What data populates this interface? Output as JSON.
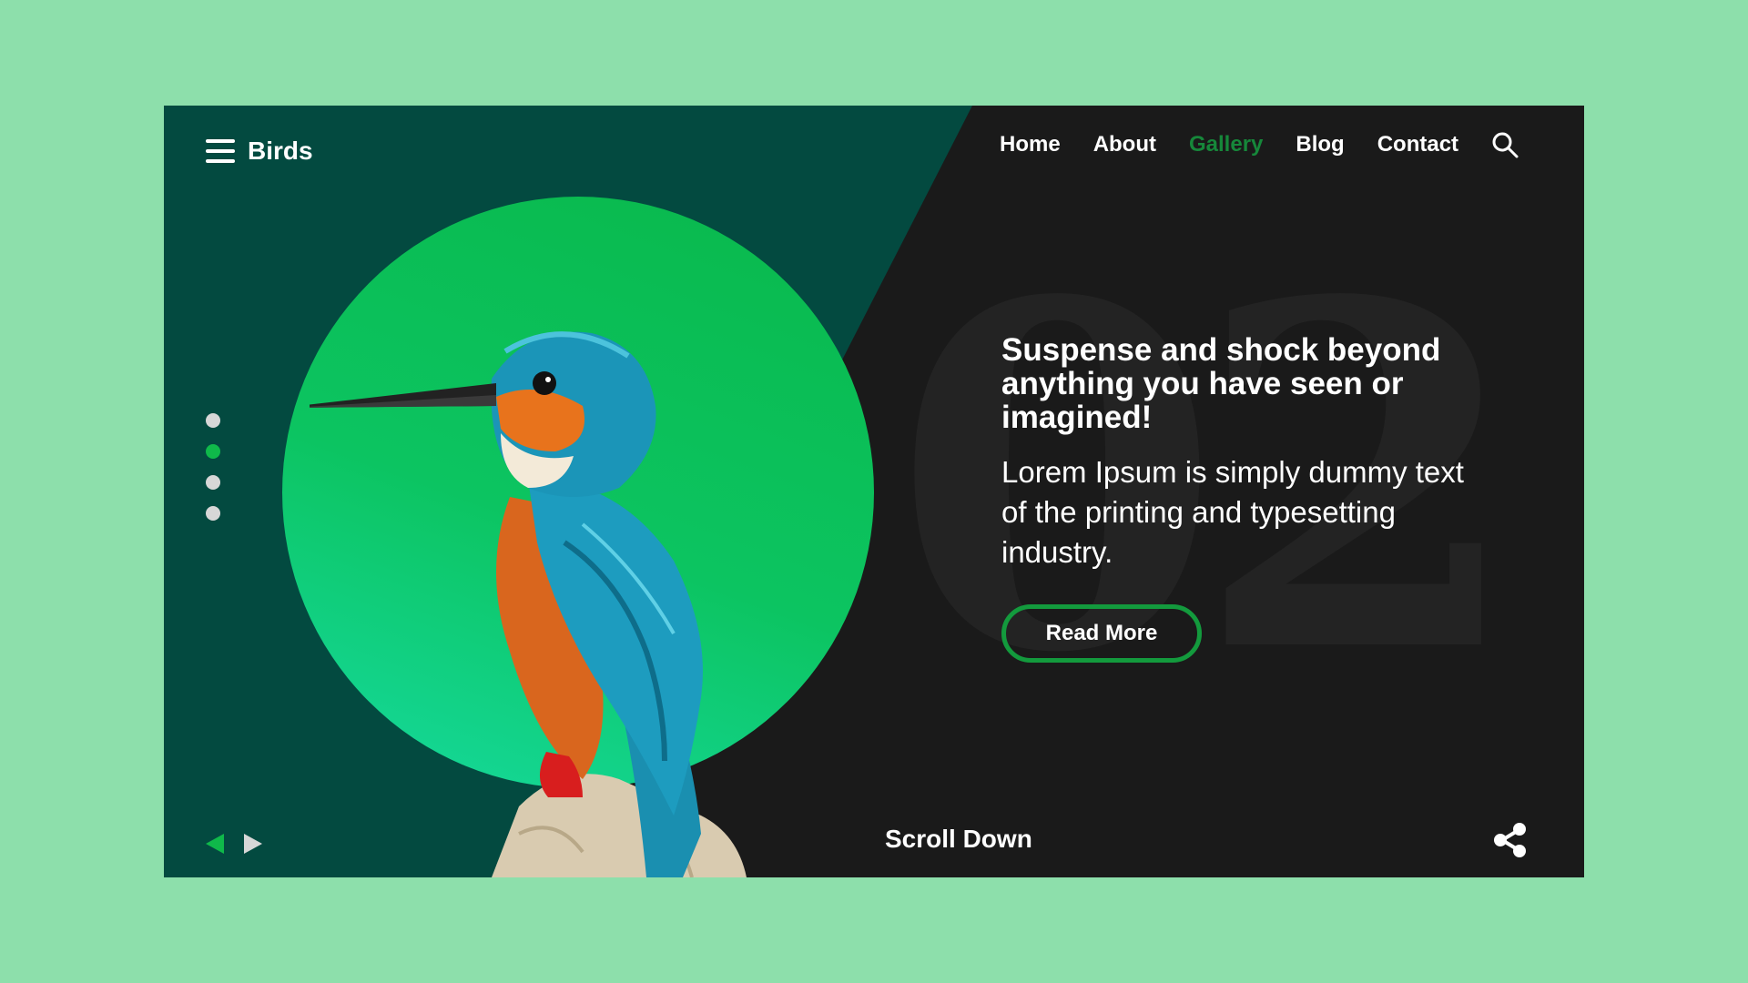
{
  "brand": {
    "name": "Birds",
    "icon": "hamburger-menu-icon"
  },
  "nav": {
    "items": [
      {
        "label": "Home",
        "active": false
      },
      {
        "label": "About",
        "active": false
      },
      {
        "label": "Gallery",
        "active": true
      },
      {
        "label": "Blog",
        "active": false
      },
      {
        "label": "Contact",
        "active": false
      }
    ],
    "search_icon": "search-icon"
  },
  "hero": {
    "background_number": "02",
    "headline": "Suspense and shock beyond anything you have seen or imagined!",
    "body": "Lorem Ipsum is simply dummy text of the printing and typesetting industry.",
    "cta_label": "Read More"
  },
  "slider": {
    "total": 4,
    "active_index": 1
  },
  "footer": {
    "scroll_label": "Scroll Down",
    "share_icon": "share-icon"
  },
  "colors": {
    "page_bg": "#8ddfab",
    "left_panel": "#034a40",
    "dark_panel": "#1a1a1a",
    "accent_green": "#0fb94a",
    "active_nav": "#16873a"
  }
}
